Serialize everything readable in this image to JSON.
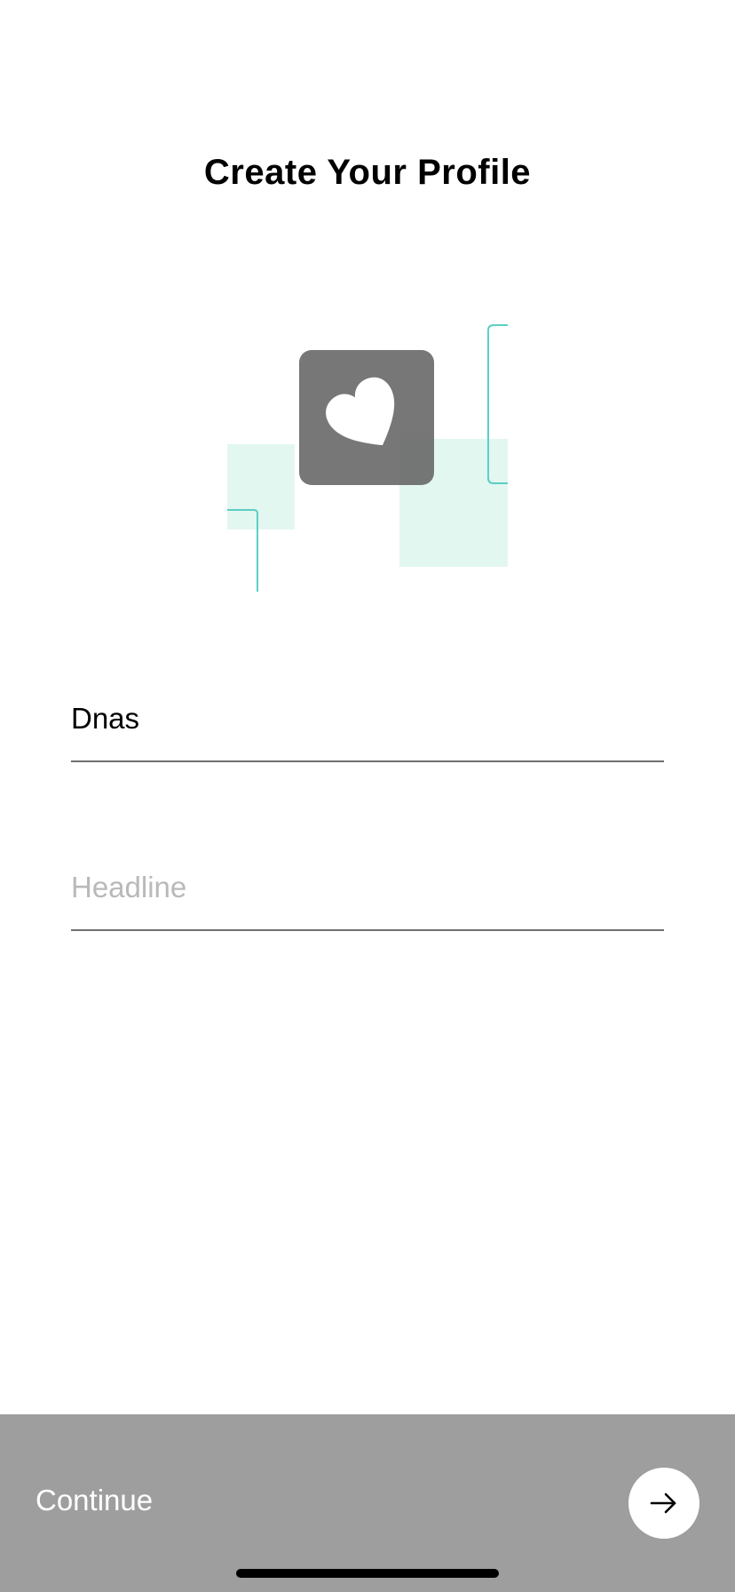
{
  "header": {
    "title": "Create Your Profile"
  },
  "avatar": {
    "icon": "heart-icon"
  },
  "form": {
    "name_value": "Dnas",
    "headline_value": "",
    "headline_placeholder": "Headline"
  },
  "footer": {
    "continue_label": "Continue",
    "next_icon": "arrow-right-icon"
  },
  "colors": {
    "accent_teal": "#5ccfc4",
    "accent_mint": "#e3f7f1",
    "avatar_bg": "#777777",
    "bar_bg": "#9e9e9e"
  }
}
